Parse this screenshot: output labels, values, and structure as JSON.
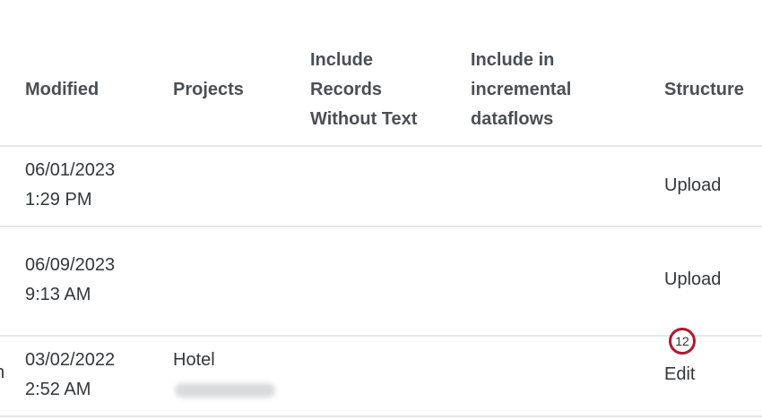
{
  "columns": {
    "modified": "Modified",
    "projects": "Projects",
    "include_records": [
      "Include",
      "Records",
      "Without Text"
    ],
    "include_incremental": [
      "Include in",
      "incremental",
      "dataflows"
    ],
    "structure": "Structure"
  },
  "rows": [
    {
      "modified_date": "06/01/2023",
      "modified_time": "1:29 PM",
      "projects": "",
      "structure": "Upload"
    },
    {
      "modified_date": "06/09/2023",
      "modified_time": "9:13 AM",
      "projects": "",
      "structure": "Upload"
    },
    {
      "leading_char": "n",
      "modified_date": "03/02/2022",
      "modified_time": "2:52 AM",
      "projects": "Hotel",
      "structure": "Edit"
    }
  ],
  "callout": {
    "number": "12",
    "color": "#b4162c"
  }
}
